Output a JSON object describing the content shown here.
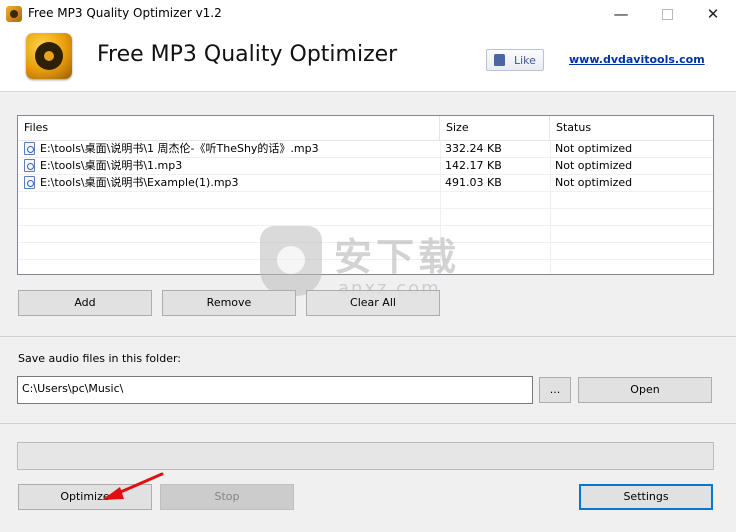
{
  "window": {
    "title": "Free MP3 Quality Optimizer v1.2",
    "controls": {
      "minimize": "—",
      "close": "✕"
    }
  },
  "header": {
    "app_name": "Free MP3 Quality Optimizer",
    "like_label": "Like",
    "site_link": "www.dvdavitools.com"
  },
  "file_list": {
    "columns": [
      "Files",
      "Size",
      "Status"
    ],
    "rows": [
      {
        "file": "E:\\tools\\桌面\\说明书\\1 周杰伦-《听TheShy的话》.mp3",
        "size": "332.24 KB",
        "status": "Not optimized"
      },
      {
        "file": "E:\\tools\\桌面\\说明书\\1.mp3",
        "size": "142.17 KB",
        "status": "Not optimized"
      },
      {
        "file": "E:\\tools\\桌面\\说明书\\Example(1).mp3",
        "size": "491.03 KB",
        "status": "Not optimized"
      }
    ]
  },
  "list_buttons": {
    "add": "Add",
    "remove": "Remove",
    "clear_all": "Clear All"
  },
  "output": {
    "label": "Save audio files in this folder:",
    "folder_value": "C:\\Users\\pc\\Music\\",
    "browse": "...",
    "open": "Open"
  },
  "progress": {
    "value": 0
  },
  "actions": {
    "optimize": "Optimize",
    "stop": "Stop",
    "settings": "Settings"
  },
  "watermark": {
    "text": "安下载",
    "sub": "anxz.com"
  },
  "colors": {
    "accent": "#0078d7",
    "link": "#0033aa",
    "annotation_arrow": "#e01010"
  }
}
